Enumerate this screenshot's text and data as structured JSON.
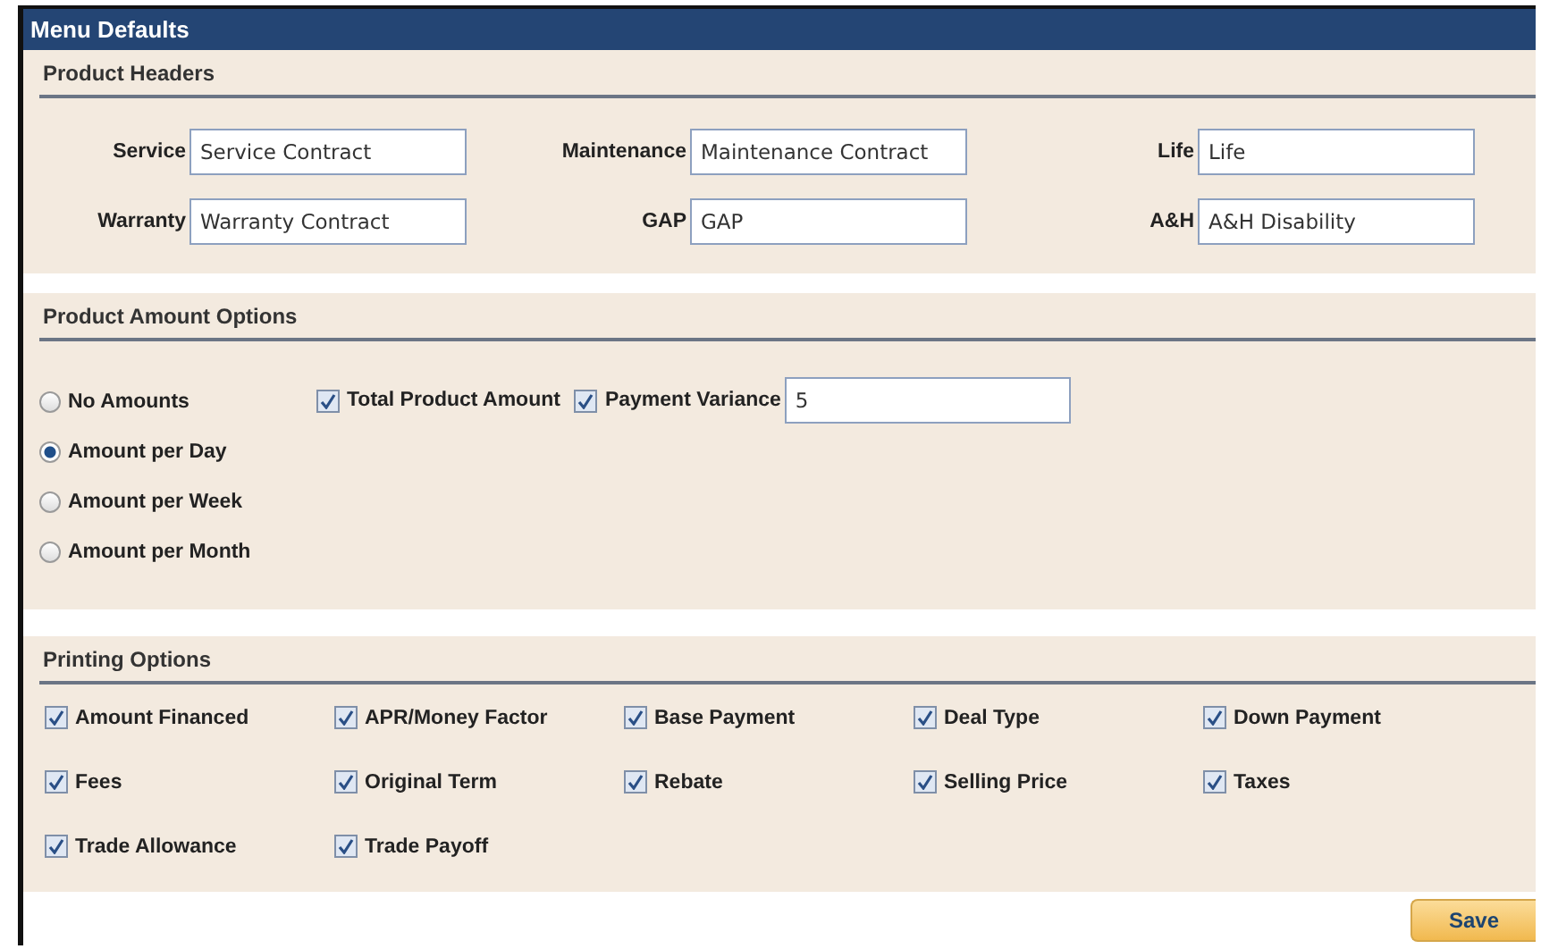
{
  "window": {
    "title": "Menu Defaults"
  },
  "product_headers": {
    "title": "Product Headers",
    "fields": [
      {
        "label": "Service",
        "value": "Service Contract"
      },
      {
        "label": "Maintenance",
        "value": "Maintenance Contract"
      },
      {
        "label": "Life",
        "value": "Life"
      },
      {
        "label": "Warranty",
        "value": "Warranty Contract"
      },
      {
        "label": "GAP",
        "value": "GAP"
      },
      {
        "label": "A&H",
        "value": "A&H Disability"
      }
    ]
  },
  "product_amount_options": {
    "title": "Product Amount Options",
    "radios": [
      {
        "label": "No Amounts",
        "selected": false
      },
      {
        "label": "Amount per Day",
        "selected": true
      },
      {
        "label": "Amount per Week",
        "selected": false
      },
      {
        "label": "Amount per Month",
        "selected": false
      }
    ],
    "total_product_amount": {
      "label": "Total Product Amount",
      "checked": true
    },
    "payment_variance": {
      "label": "Payment Variance",
      "checked": true,
      "value": "5"
    }
  },
  "printing_options": {
    "title": "Printing Options",
    "items": [
      {
        "label": "Amount Financed",
        "checked": true
      },
      {
        "label": "APR/Money Factor",
        "checked": true
      },
      {
        "label": "Base Payment",
        "checked": true
      },
      {
        "label": "Deal Type",
        "checked": true
      },
      {
        "label": "Down Payment",
        "checked": true
      },
      {
        "label": "Fees",
        "checked": true
      },
      {
        "label": "Original Term",
        "checked": true
      },
      {
        "label": "Rebate",
        "checked": true
      },
      {
        "label": "Selling Price",
        "checked": true
      },
      {
        "label": "Taxes",
        "checked": true
      },
      {
        "label": "Trade Allowance",
        "checked": true
      },
      {
        "label": "Trade Payoff",
        "checked": true
      }
    ]
  },
  "save_button": "Save"
}
